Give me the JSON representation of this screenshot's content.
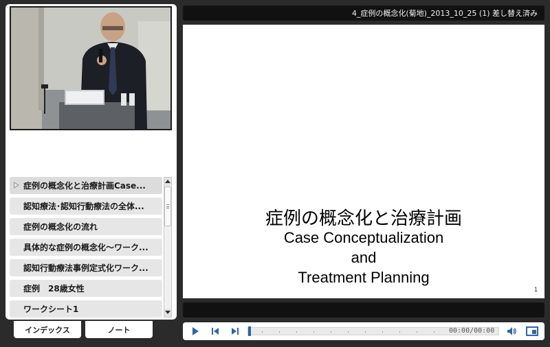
{
  "header": {
    "title": "4_症例の概念化(菊地)_2013_10_25 (1) 差し替え済み"
  },
  "index": {
    "items": [
      {
        "label": "症例の概念化と治療計画Case...",
        "active": true
      },
      {
        "label": "認知療法･認知行動療法の全体...",
        "active": false
      },
      {
        "label": "症例の概念化の流れ",
        "active": false
      },
      {
        "label": "具体的な症例の概念化～ワーク...",
        "active": false
      },
      {
        "label": "認知行動療法事例定式化ワーク...",
        "active": false
      },
      {
        "label": "症例　28歳女性",
        "active": false
      },
      {
        "label": "ワークシート1",
        "active": false
      }
    ]
  },
  "tabs": {
    "index_label": "インデックス",
    "note_label": "ノート"
  },
  "slide": {
    "title_jp": "症例の概念化と治療計画",
    "title_en_line1": "Case Conceptualization",
    "title_en_line2": "and",
    "title_en_line3": "Treatment Planning",
    "page_number": "1"
  },
  "player": {
    "time": "00:00/00:00",
    "progress": 0.0,
    "accent_color": "#3a74b8",
    "icons": [
      "play-icon",
      "previous-icon",
      "next-icon",
      "volume-icon",
      "screen-layout-icon"
    ]
  }
}
